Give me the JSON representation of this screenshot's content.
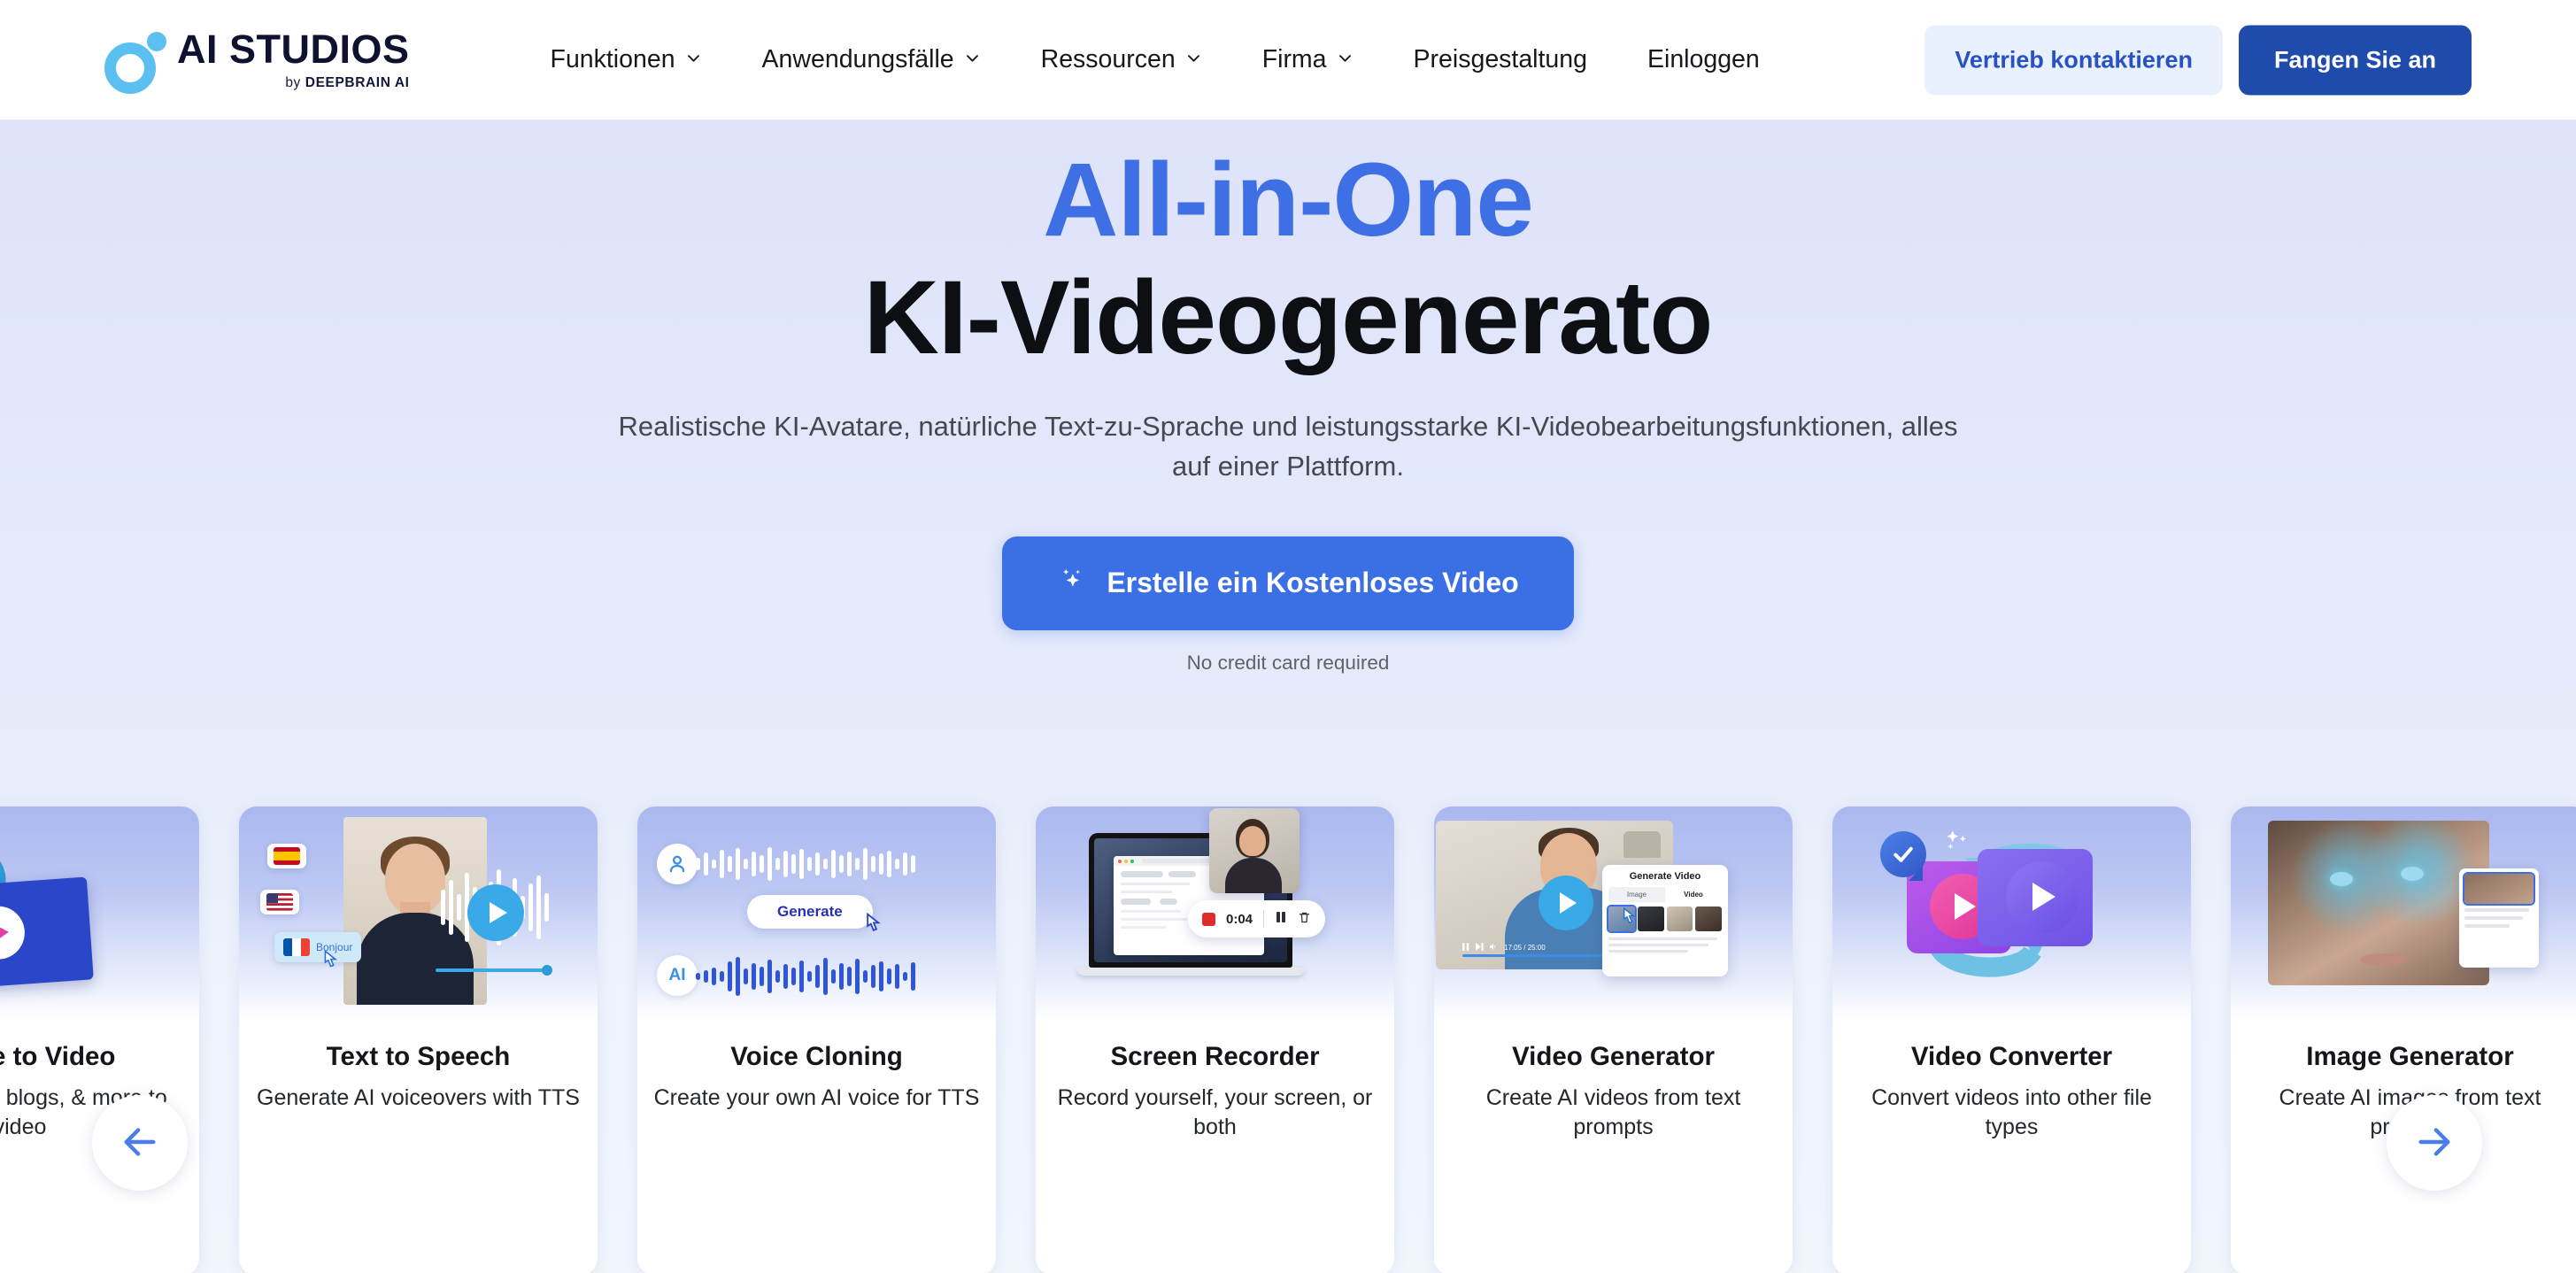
{
  "header": {
    "logo": {
      "name": "AI STUDIOS",
      "sub_prefix": "by ",
      "sub_brand": "DEEPBRAIN AI"
    },
    "nav": [
      {
        "label": "Funktionen",
        "has_chevron": true
      },
      {
        "label": "Anwendungsfälle",
        "has_chevron": true
      },
      {
        "label": "Ressourcen",
        "has_chevron": true
      },
      {
        "label": "Firma",
        "has_chevron": true
      },
      {
        "label": "Preisgestaltung",
        "has_chevron": false
      },
      {
        "label": "Einloggen",
        "has_chevron": false
      }
    ],
    "contact_sales_label": "Vertrieb kontaktieren",
    "get_started_label": "Fangen Sie an",
    "accent_blue": "#1f4bad",
    "ghost_bg": "#e9f1fe"
  },
  "hero": {
    "title_accent": "All-in-One",
    "title_main": "KI-Videogenerato",
    "accent_color": "#3f6fe4",
    "subtitle_line1": "Realistische KI-Avatare, natürliche Text-zu-Sprache und leistungsstarke KI-Videobearbeitungsfunktionen, alles",
    "subtitle_line2": "auf einer Plattform.",
    "cta_label": "Erstelle ein Kostenloses Video",
    "cta_color": "#3b6fe6",
    "cta_note": "No credit card required"
  },
  "carousel": {
    "prev_label": "Vorherige",
    "next_label": "Nächste",
    "cards": [
      {
        "title": "Article to Video",
        "desc": "Turn articles, blogs, & more to video"
      },
      {
        "title": "Text to Speech",
        "desc": "Generate AI voiceovers with TTS"
      },
      {
        "title": "Voice Cloning",
        "desc": "Create your own AI voice for TTS"
      },
      {
        "title": "Screen Recorder",
        "desc": "Record yourself, your screen, or both"
      },
      {
        "title": "Video Generator",
        "desc": "Create AI videos from text prompts"
      },
      {
        "title": "Video Converter",
        "desc": "Convert videos into other file types"
      },
      {
        "title": "Image Generator",
        "desc": "Create AI images from text prompts"
      }
    ],
    "art": {
      "tts_chip_label": "Bonjour",
      "voice_generate_label": "Generate",
      "voice_user_badge": "person-icon",
      "voice_ai_badge": "AI",
      "recorder_time": "0:04",
      "video_gen_panel_title": "Generate Video",
      "video_gen_tab_image": "Image",
      "video_gen_tab_video": "Video",
      "video_gen_timecode": "17:05 / 25:00"
    }
  }
}
